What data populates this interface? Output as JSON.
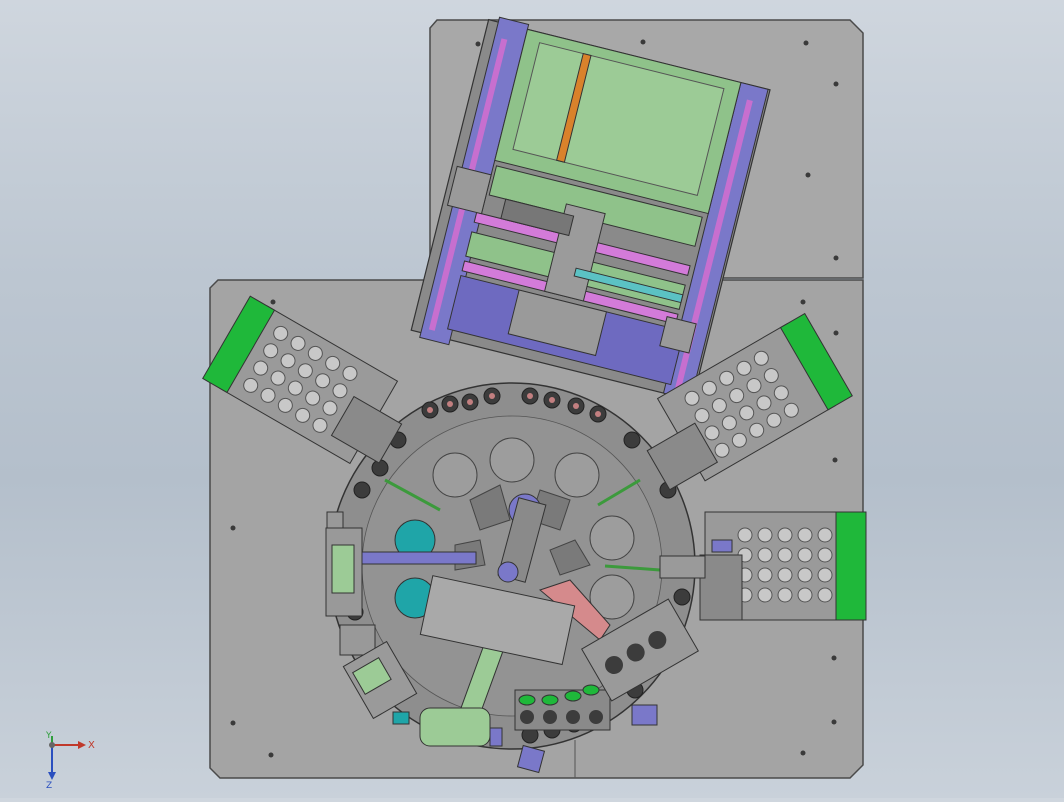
{
  "window": {
    "title": ""
  },
  "viewport": {
    "background_top": "#cfd6de",
    "background_bottom": "#b4bfcb",
    "plate_color": "#a6a6a6",
    "plate_edge": "#4a4a4a",
    "dial_color": "#8f8f8f",
    "accent_green": "#1fb83a",
    "accent_purple": "#7a78c9",
    "accent_magenta": "#d37bd9",
    "accent_teal": "#1fa5a8",
    "accent_orange": "#d9822b",
    "light_green": "#8fc28a"
  },
  "triad": {
    "x_label": "X",
    "y_label": "Y",
    "z_label": "Z",
    "icons": [
      "x-axis-arrow-icon",
      "y-axis-arrow-icon",
      "z-axis-arrow-icon"
    ]
  }
}
